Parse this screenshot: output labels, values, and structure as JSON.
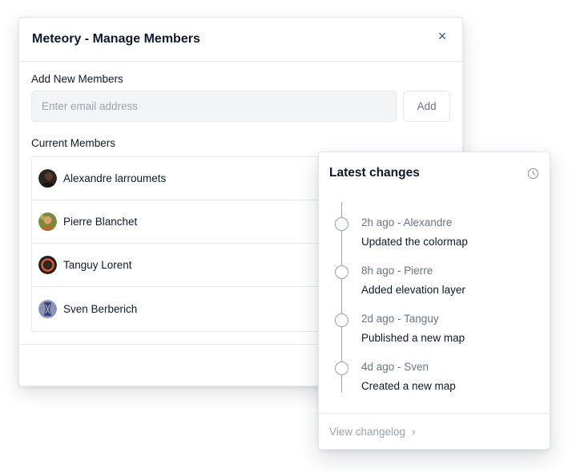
{
  "modal": {
    "title": "Meteory - Manage Members",
    "close_icon": "close-icon",
    "add_section_label": "Add New Members",
    "email_placeholder": "Enter email address",
    "email_value": "",
    "add_button_label": "Add",
    "current_section_label": "Current Members",
    "members": [
      {
        "name": "Alexandre larroumets",
        "avatar_icon": "avatar-dark"
      },
      {
        "name": "Pierre Blanchet",
        "avatar_icon": "avatar-photo"
      },
      {
        "name": "Tanguy Lorent",
        "avatar_icon": "avatar-orange-ring"
      },
      {
        "name": "Sven Berberich",
        "avatar_icon": "avatar-blue"
      }
    ]
  },
  "changes": {
    "title": "Latest changes",
    "header_icon": "clock-icon",
    "items": [
      {
        "meta": "2h ago - Alexandre",
        "description": "Updated the colormap"
      },
      {
        "meta": "8h ago - Pierre",
        "description": "Added elevation layer"
      },
      {
        "meta": "2d ago - Tanguy",
        "description": "Published a new map"
      },
      {
        "meta": "4d ago - Sven",
        "description": "Created a new map"
      }
    ],
    "footer_link": "View changelog",
    "footer_icon": "chevron-right-icon"
  },
  "colors": {
    "border": "#e5e7eb",
    "text_primary": "#111827",
    "text_muted": "#6b7280",
    "input_bg": "#f3f4f6",
    "timeline_gray": "#9ca3af"
  }
}
